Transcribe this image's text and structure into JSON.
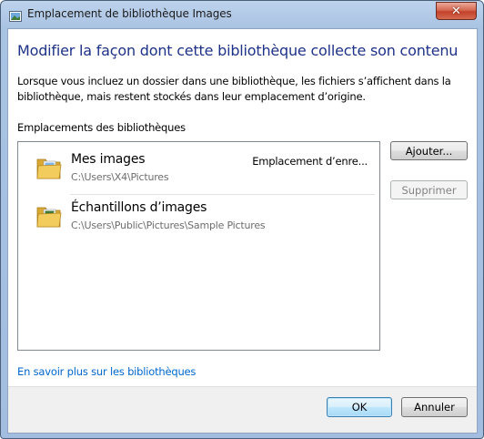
{
  "window": {
    "title": "Emplacement de bibliothèque Images",
    "close_label": "✕"
  },
  "dialog": {
    "heading": "Modifier la façon dont cette bibliothèque collecte son contenu",
    "description": "Lorsque vous incluez un dossier dans une bibliothèque, les fichiers s’affichent dans la bibliothèque, mais restent stockés dans leur emplacement d’origine.",
    "locations_label": "Emplacements des bibliothèques",
    "locations": [
      {
        "name": "Mes images",
        "path": "C:\\Users\\X4\\Pictures",
        "status": "Emplacement d’enre..."
      },
      {
        "name": "Échantillons d’images",
        "path": "C:\\Users\\Public\\Pictures\\Sample Pictures",
        "status": ""
      }
    ],
    "add_button": "Ajouter...",
    "add_button_accel": "A",
    "remove_button": "Supprimer",
    "learn_more_link": "En savoir plus sur les bibliothèques"
  },
  "footer": {
    "ok_button": "OK",
    "cancel_button": "Annuler"
  },
  "icons": {
    "title": "library-images-icon",
    "folder1": "folder-pictures-icon",
    "folder2": "folder-pictures-icon"
  },
  "colors": {
    "heading": "#1e3287",
    "link": "#0066cc",
    "close_button": "#c4412a"
  }
}
